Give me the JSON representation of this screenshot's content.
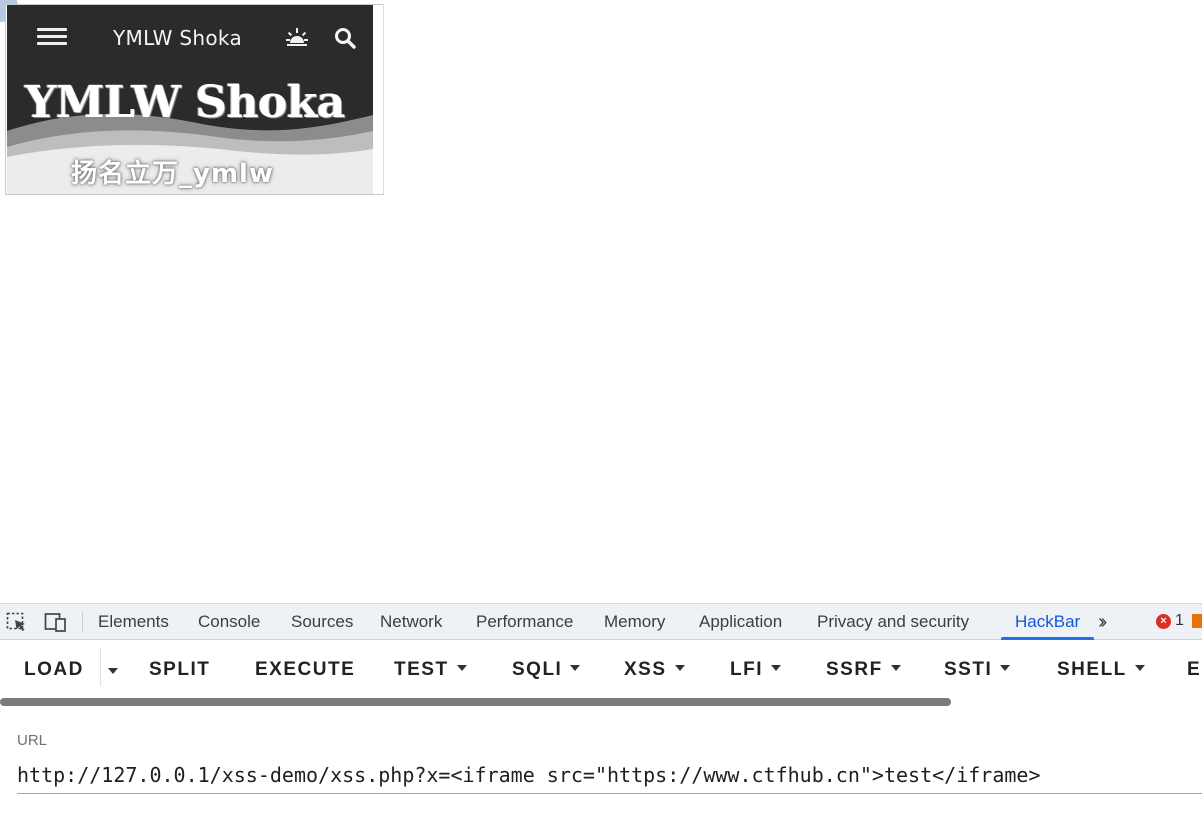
{
  "embedded_page": {
    "site_name": "YMLW Shoka",
    "banner_title": "YMLW Shoka",
    "banner_subtitle": "扬名立万_ymlw",
    "icons": [
      "menu-icon",
      "sunrise-icon",
      "search-icon"
    ]
  },
  "devtools": {
    "tabs": [
      {
        "label": "Elements"
      },
      {
        "label": "Console"
      },
      {
        "label": "Sources"
      },
      {
        "label": "Network"
      },
      {
        "label": "Performance"
      },
      {
        "label": "Memory"
      },
      {
        "label": "Application"
      },
      {
        "label": "Privacy and security"
      },
      {
        "label": "HackBar",
        "active": true
      }
    ],
    "error_count": "1",
    "accent_color": "#1a73e8"
  },
  "hackbar": {
    "buttons": {
      "load": "LOAD",
      "split": "SPLIT",
      "execute": "EXECUTE",
      "test": "TEST",
      "sqli": "SQLI",
      "xss": "XSS",
      "lfi": "LFI",
      "ssrf": "SSRF",
      "ssti": "SSTI",
      "shell": "SHELL",
      "truncated": "EI"
    },
    "url_label": "URL",
    "url_value": "http://127.0.0.1/xss-demo/xss.php?x=<iframe src=\"https://www.ctfhub.cn\">test</iframe>"
  }
}
